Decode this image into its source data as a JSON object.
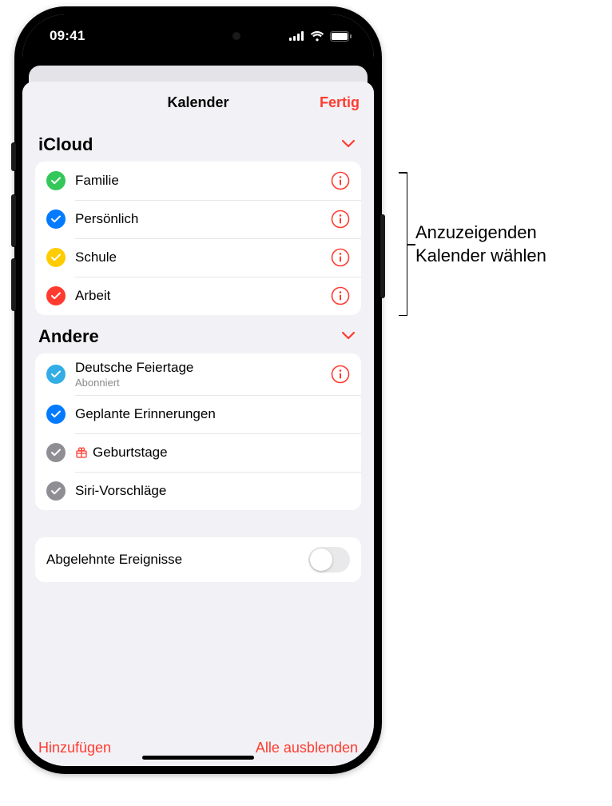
{
  "status": {
    "time": "09:41"
  },
  "sheet": {
    "title": "Kalender",
    "done": "Fertig"
  },
  "sections": {
    "icloud": {
      "title": "iCloud",
      "items": [
        {
          "label": "Familie",
          "color": "#34c759"
        },
        {
          "label": "Persönlich",
          "color": "#007aff"
        },
        {
          "label": "Schule",
          "color": "#ffcc00"
        },
        {
          "label": "Arbeit",
          "color": "#ff3b30"
        }
      ]
    },
    "other": {
      "title": "Andere",
      "items": [
        {
          "label": "Deutsche Feiertage",
          "sub": "Abonniert",
          "color": "#32ade6"
        },
        {
          "label": "Geplante Erinnerungen",
          "color": "#007aff"
        },
        {
          "label": "Geburtstage",
          "color": "#8e8e93"
        },
        {
          "label": "Siri-Vorschläge",
          "color": "#8e8e93"
        }
      ]
    }
  },
  "toggle": {
    "label": "Abgelehnte Ereignisse"
  },
  "footer": {
    "add": "Hinzufügen",
    "hide_all": "Alle ausblenden"
  },
  "callout": {
    "line1": "Anzuzeigenden",
    "line2": "Kalender wählen"
  },
  "colors": {
    "accent": "#ff3b30"
  }
}
